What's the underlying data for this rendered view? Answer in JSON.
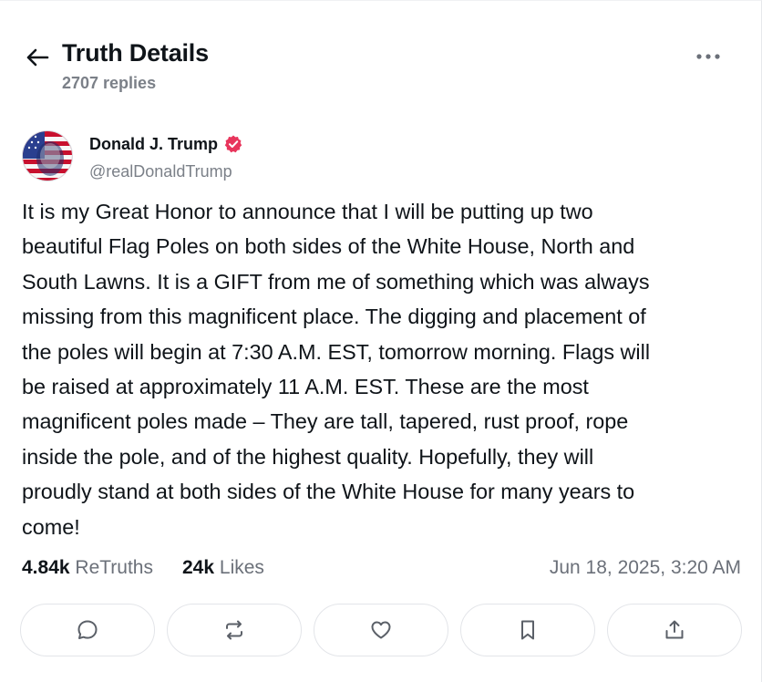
{
  "header": {
    "title": "Truth Details",
    "replies": "2707 replies"
  },
  "author": {
    "name": "Donald J. Trump",
    "handle": "@realDonaldTrump",
    "verified": true
  },
  "post": {
    "text": "It is my Great Honor to announce that I will be putting up two\nbeautiful Flag Poles on both sides of the White House, North and\nSouth Lawns. It is a GIFT from me of something which was always\nmissing from this magnificent place. The digging and placement of\nthe poles will begin at 7:30 A.M. EST, tomorrow morning. Flags will\nbe raised at approximately 11 A.M. EST. These are the most\nmagnificent poles made – They are tall, tapered, rust proof, rope\ninside the pole, and of the highest quality. Hopefully, they will\nproudly stand at both sides of the White House for many years to\ncome!"
  },
  "stats": {
    "retruths_count": "4.84k",
    "retruths_label": "ReTruths",
    "likes_count": "24k",
    "likes_label": "Likes",
    "timestamp": "Jun 18, 2025, 3:20 AM"
  },
  "actions": [
    {
      "icon": "reply-icon"
    },
    {
      "icon": "retruth-icon"
    },
    {
      "icon": "heart-icon"
    },
    {
      "icon": "bookmark-icon"
    },
    {
      "icon": "share-icon"
    }
  ],
  "colors": {
    "text": "#0f1419",
    "muted": "#7b8088",
    "verified_badge": "#e8355c",
    "border": "#e3e5e9"
  }
}
